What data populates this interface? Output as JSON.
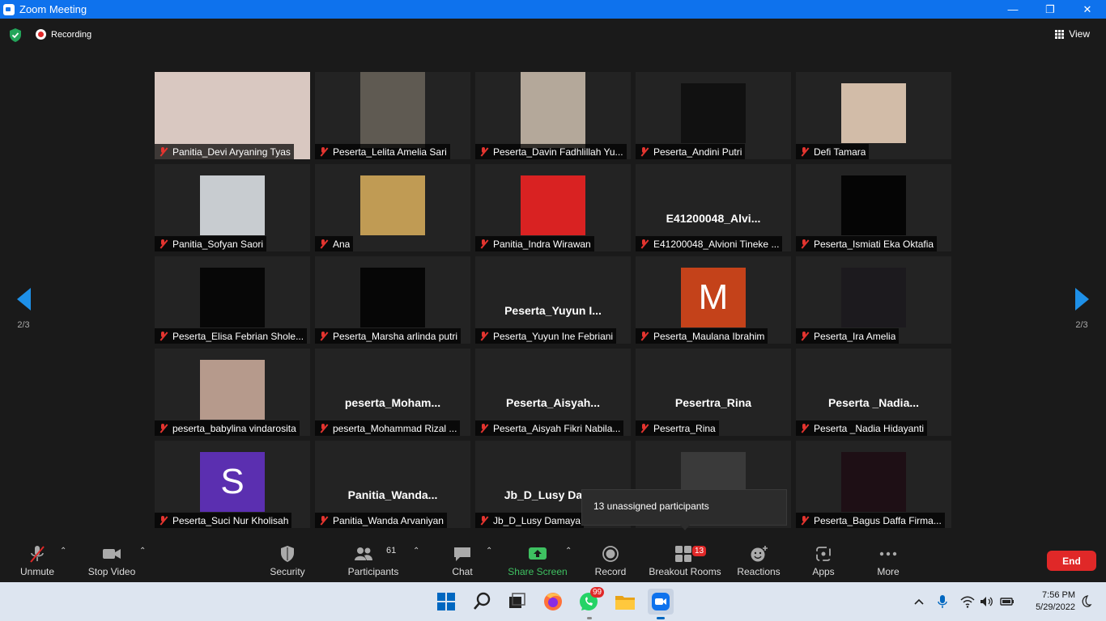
{
  "window": {
    "title": "Zoom Meeting",
    "controls": [
      "minimize",
      "maximize",
      "close"
    ]
  },
  "topbar": {
    "recording_label": "Recording",
    "view_label": "View"
  },
  "pagination": {
    "left_page": "2/3",
    "right_page": "2/3"
  },
  "participants": [
    {
      "caption": "Panitia_Devi Aryaning Tyas",
      "display": "video-full",
      "bg": "#d9c8c1"
    },
    {
      "caption": "Peserta_Lelita Amelia Sari",
      "display": "video",
      "bg": "#5f5a52"
    },
    {
      "caption": "Peserta_Davin Fadhlillah Yu...",
      "display": "video",
      "bg": "#b4a89a"
    },
    {
      "caption": "Peserta_Andini Putri",
      "display": "video-mid",
      "bg": "#111111"
    },
    {
      "caption": "Defi Tamara",
      "display": "video-mid",
      "bg": "#d2bca8"
    },
    {
      "caption": "Panitia_Sofyan Saori",
      "display": "video-mid",
      "bg": "#c8ccd0"
    },
    {
      "caption": "Ana",
      "display": "video-mid",
      "bg": "#c09b54"
    },
    {
      "caption": "Panitia_Indra Wirawan",
      "display": "video-mid",
      "bg": "#d92222"
    },
    {
      "caption": "E41200048_Alvioni Tineke ...",
      "display": "name",
      "bigname": "E41200048_Alvi..."
    },
    {
      "caption": "Peserta_Ismiati Eka Oktafia",
      "display": "video-mid",
      "bg": "#050505"
    },
    {
      "caption": "Peserta_Elisa Febrian Shole...",
      "display": "video-mid",
      "bg": "#070707"
    },
    {
      "caption": "Peserta_Marsha arlinda putri",
      "display": "video-mid",
      "bg": "#060606"
    },
    {
      "caption": "Peserta_Yuyun Ine Febriani",
      "display": "name",
      "bigname": "Peserta_Yuyun  I..."
    },
    {
      "caption": "Peserta_Maulana Ibrahim",
      "display": "avatar",
      "letter": "M",
      "bg": "#c4421a"
    },
    {
      "caption": "Peserta_Ira Amelia",
      "display": "video-mid",
      "bg": "#1c1a1e"
    },
    {
      "caption": "peserta_babylina vindarosita",
      "display": "video-mid",
      "bg": "#b69a8c"
    },
    {
      "caption": "peserta_Mohammad Rizal ...",
      "display": "name",
      "bigname": "peserta_Moham..."
    },
    {
      "caption": "Peserta_Aisyah Fikri Nabila...",
      "display": "name",
      "bigname": "Peserta_Aisyah..."
    },
    {
      "caption": "Pesertra_Rina",
      "display": "name",
      "bigname": "Pesertra_Rina"
    },
    {
      "caption": "Peserta _Nadia Hidayanti",
      "display": "name",
      "bigname": "Peserta  _Nadia..."
    },
    {
      "caption": "Peserta_Suci Nur Kholisah",
      "display": "avatar",
      "letter": "S",
      "bg": "#5b2fb0"
    },
    {
      "caption": "Panitia_Wanda Arvaniyan",
      "display": "name",
      "bigname": "Panitia_Wanda..."
    },
    {
      "caption": "Jb_D_Lusy Damaya",
      "display": "name",
      "bigname": "Jb_D_Lusy  Dam..."
    },
    {
      "caption": "",
      "display": "video-mid",
      "bg": "#3a3a3a"
    },
    {
      "caption": "Peserta_Bagus Daffa Firma...",
      "display": "video-mid",
      "bg": "#1e0f15"
    }
  ],
  "tooltip": {
    "text": "13 unassigned participants"
  },
  "toolbar": {
    "unmute": "Unmute",
    "stop_video": "Stop Video",
    "security": "Security",
    "participants": "Participants",
    "participants_count": "61",
    "chat": "Chat",
    "share_screen": "Share Screen",
    "record": "Record",
    "breakout_rooms": "Breakout Rooms",
    "breakout_badge": "13",
    "reactions": "Reactions",
    "apps": "Apps",
    "more": "More",
    "end": "End"
  },
  "taskbar": {
    "whatsapp_badge": "99",
    "time": "7:56 PM",
    "date": "5/29/2022"
  },
  "colors": {
    "zoom_blue": "#0e72ed",
    "end_red": "#e02828",
    "share_green": "#3ec161"
  }
}
